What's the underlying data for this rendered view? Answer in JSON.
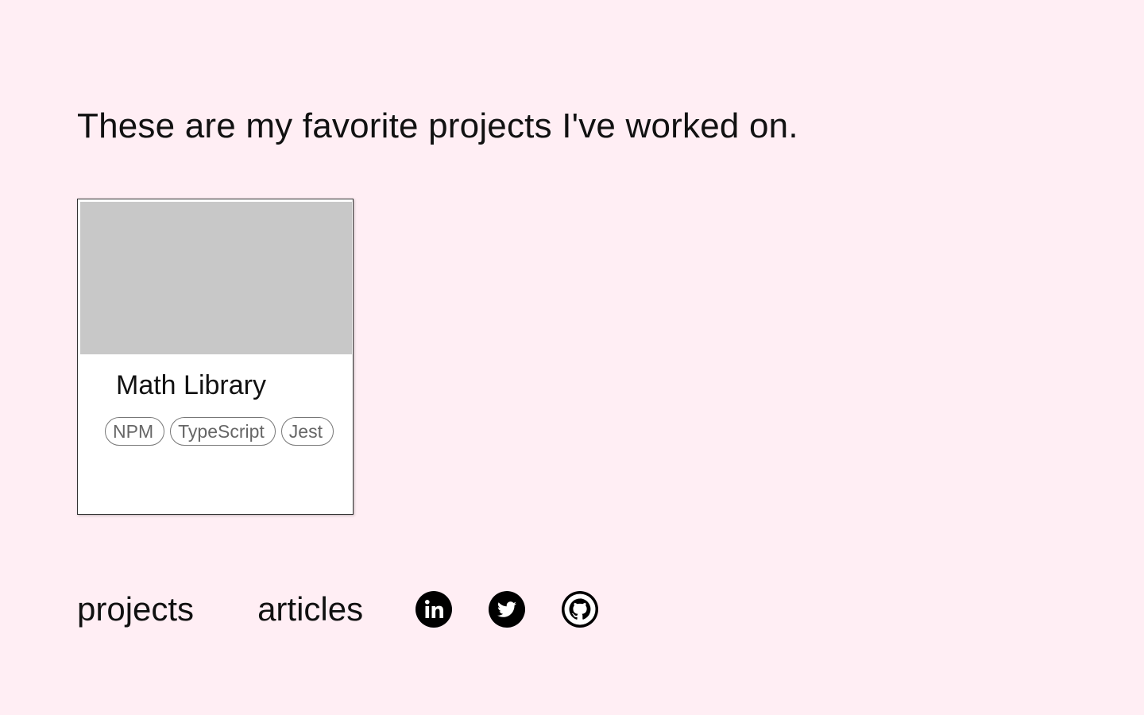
{
  "intro": {
    "text": "These are my favorite projects I've worked on."
  },
  "projects": [
    {
      "title": "Math Library",
      "tags": [
        "NPM",
        "TypeScript",
        "Jest"
      ]
    }
  ],
  "nav": {
    "projects_label": "projects",
    "articles_label": "articles"
  },
  "social": [
    {
      "icon": "linkedin-icon"
    },
    {
      "icon": "twitter-icon"
    },
    {
      "icon": "github-icon"
    }
  ],
  "colors": {
    "background": "#ffeef4",
    "card_background": "#ffffff",
    "image_placeholder": "#c8c8c8",
    "text": "#111111",
    "tag_text": "#666666"
  }
}
